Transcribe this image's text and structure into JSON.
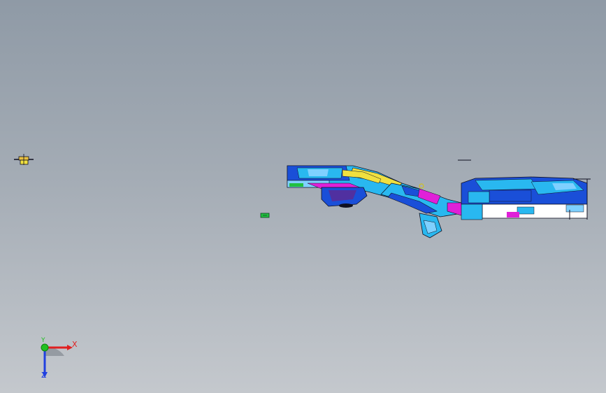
{
  "viewport": {
    "background_top": "#8f9aa6",
    "background_bottom": "#c4c8cd"
  },
  "triad": {
    "x_label": "X",
    "y_label": "Y",
    "z_label": "Z",
    "x_color": "#e02020",
    "y_color": "#20c020",
    "z_color": "#2040e0"
  },
  "model": {
    "palette": {
      "blue": "#1a4fd8",
      "cyan": "#29b8f0",
      "light_blue": "#7fd0ff",
      "yellow": "#f0e040",
      "magenta": "#e020d8",
      "white": "#ffffff",
      "dark": "#101020",
      "green": "#20c040"
    }
  },
  "small_parts": {
    "left_part_icon": "bracket-icon",
    "green_tag_icon": "green-tag-icon"
  }
}
